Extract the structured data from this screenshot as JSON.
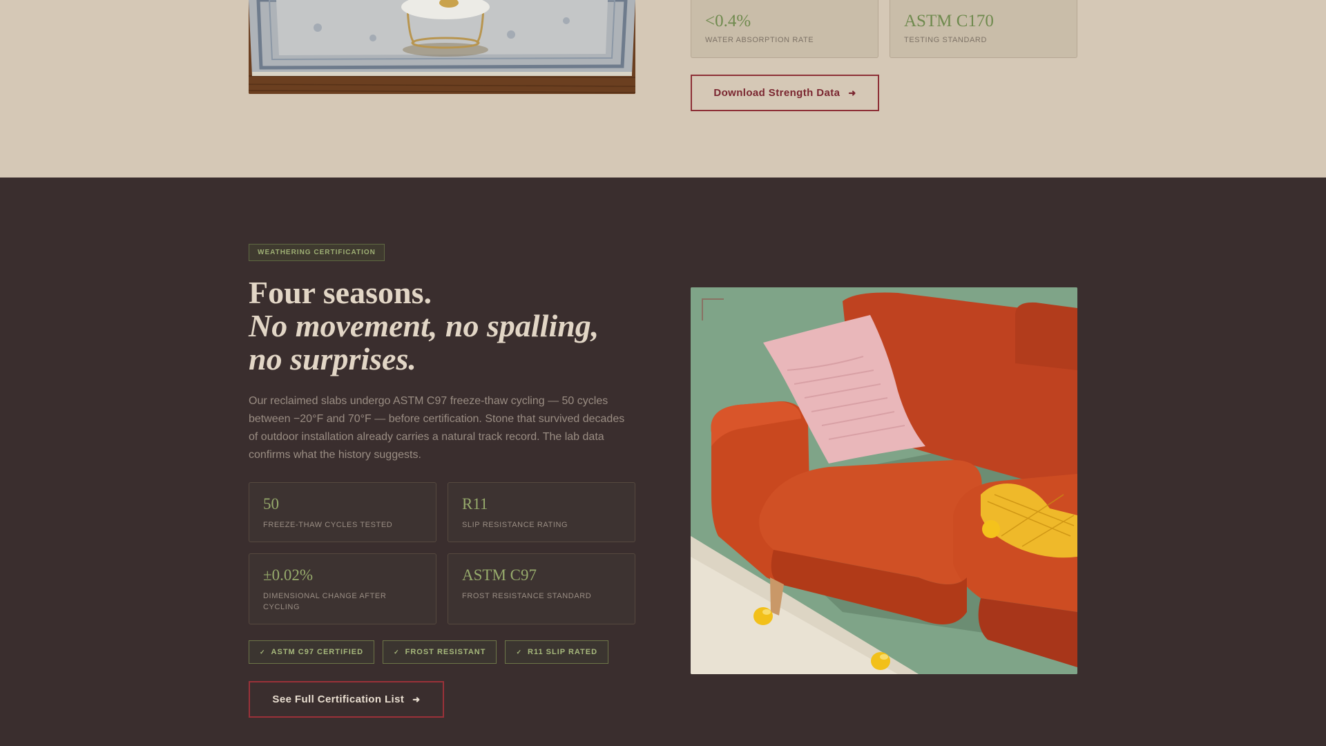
{
  "top": {
    "stats": [
      {
        "value": "<0.4%",
        "label": "WATER ABSORPTION RATE"
      },
      {
        "value": "ASTM C170",
        "label": "TESTING STANDARD"
      }
    ],
    "download_button": {
      "label": "Download Strength Data",
      "icon": "arrow-right-icon"
    }
  },
  "weathering": {
    "eyebrow": "WEATHERING CERTIFICATION",
    "headline_line1": "Four seasons.",
    "headline_line2": "No movement, no spalling, no surprises.",
    "body": "Our reclaimed slabs undergo ASTM C97 freeze-thaw cycling — 50 cycles between −20°F and 70°F — before certification. Stone that survived decades of outdoor installation already carries a natural track record. The lab data confirms what the history suggests.",
    "stats": [
      {
        "value": "50",
        "label": "FREEZE-THAW CYCLES TESTED"
      },
      {
        "value": "R11",
        "label": "SLIP RESISTANCE RATING"
      },
      {
        "value": "±0.02%",
        "label": "DIMENSIONAL CHANGE AFTER CYCLING"
      },
      {
        "value": "ASTM C97",
        "label": "FROST RESISTANCE STANDARD"
      }
    ],
    "badges": [
      {
        "check": "✓",
        "label": "ASTM C97 CERTIFIED"
      },
      {
        "check": "✓",
        "label": "FROST RESISTANT"
      },
      {
        "check": "✓",
        "label": "R11 SLIP RATED"
      }
    ],
    "cta_button": {
      "label": "See Full Certification List",
      "icon": "arrow-right-icon"
    }
  },
  "colors": {
    "top_background": "#d5c8b6",
    "dark_background": "#3a2e2e",
    "accent_green": "#97ab6c",
    "accent_red": "#9a3139",
    "headline_text": "#e2d6c6"
  }
}
